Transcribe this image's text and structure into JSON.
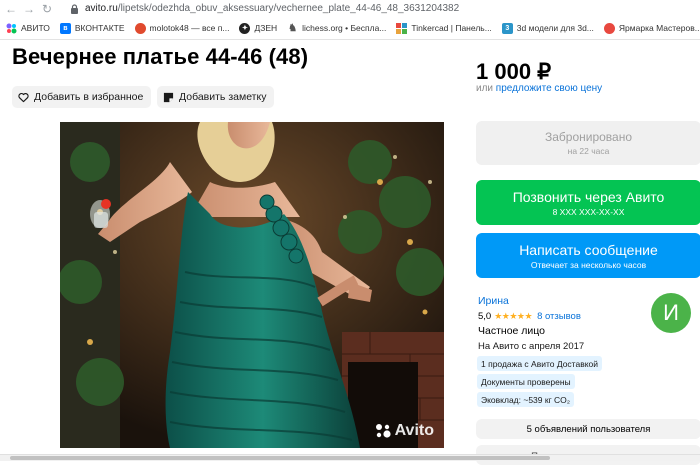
{
  "browser": {
    "url_host": "avito.ru",
    "url_path": "/lipetsk/odezhda_obuv_aksessuary/vechernee_plate_44-46_48_3631204382",
    "bookmarks": [
      {
        "label": "АВИТО",
        "icon": "avito-icon",
        "color": "#7b61ff"
      },
      {
        "label": "ВКОНТАКТЕ",
        "icon": "vk-icon",
        "color": "#0077ff"
      },
      {
        "label": "molotok48 — все п...",
        "icon": "molotok-icon",
        "color": "#e04a2e"
      },
      {
        "label": "ДЗЕН",
        "icon": "dzen-icon",
        "color": "#222222"
      },
      {
        "label": "lichess.org • Беспла...",
        "icon": "lichess-icon",
        "color": "#555555"
      },
      {
        "label": "Tinkercad | Панель...",
        "icon": "tinkercad-icon",
        "color": "#e8a33d"
      },
      {
        "label": "3d модели для 3d...",
        "icon": "3d-models-icon",
        "color": "#2b95c9"
      },
      {
        "label": "Ярмарка Мастеров...",
        "icon": "yarmarka-icon",
        "color": "#e8483f"
      }
    ]
  },
  "listing": {
    "title": "Вечернее платье 44-46 (48)",
    "favorite_label": "Добавить в избранное",
    "note_label": "Добавить заметку",
    "watermark": "Avito"
  },
  "sidebar": {
    "price": "1 000 ₽",
    "offer_prefix": "или ",
    "offer_link": "предложите свою цену",
    "reserved_label": "Забронировано",
    "reserved_sub": "на 22 часа",
    "call_label": "Позвонить через Авито",
    "call_sub": "8 XXX XXX-XX-XX",
    "msg_label": "Написать сообщение",
    "msg_sub": "Отвечает за несколько часов",
    "accent_green": "#04c453",
    "accent_blue": "#0099f7"
  },
  "seller": {
    "name": "Ирина",
    "rating": "5,0",
    "stars": "★★★★★",
    "reviews": "8 отзывов",
    "type": "Частное лицо",
    "since": "На Авито с апреля 2017",
    "avatar_letter": "И",
    "badges": [
      "1 продажа с Авито Доставкой",
      "Документы проверены",
      "Эковклад: ~539 кг CO₂"
    ],
    "ads_label": "5 объявлений пользователя",
    "subscribe_label": "Подписаться на продавца"
  }
}
